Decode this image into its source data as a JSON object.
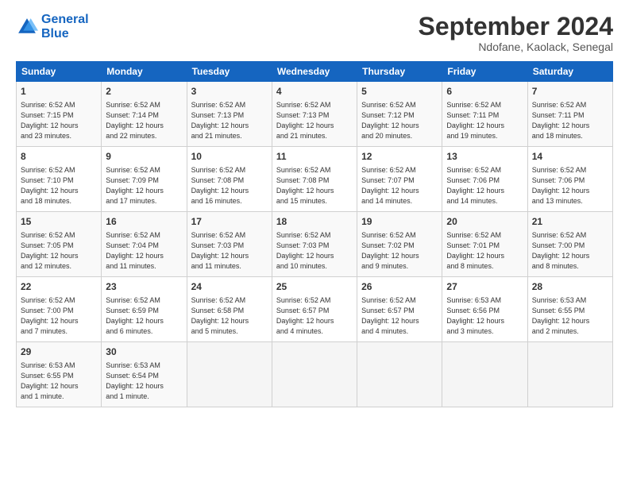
{
  "logo": {
    "line1": "General",
    "line2": "Blue"
  },
  "title": "September 2024",
  "subtitle": "Ndofane, Kaolack, Senegal",
  "days_of_week": [
    "Sunday",
    "Monday",
    "Tuesday",
    "Wednesday",
    "Thursday",
    "Friday",
    "Saturday"
  ],
  "weeks": [
    [
      {
        "day": "1",
        "info": "Sunrise: 6:52 AM\nSunset: 7:15 PM\nDaylight: 12 hours\nand 23 minutes."
      },
      {
        "day": "2",
        "info": "Sunrise: 6:52 AM\nSunset: 7:14 PM\nDaylight: 12 hours\nand 22 minutes."
      },
      {
        "day": "3",
        "info": "Sunrise: 6:52 AM\nSunset: 7:13 PM\nDaylight: 12 hours\nand 21 minutes."
      },
      {
        "day": "4",
        "info": "Sunrise: 6:52 AM\nSunset: 7:13 PM\nDaylight: 12 hours\nand 21 minutes."
      },
      {
        "day": "5",
        "info": "Sunrise: 6:52 AM\nSunset: 7:12 PM\nDaylight: 12 hours\nand 20 minutes."
      },
      {
        "day": "6",
        "info": "Sunrise: 6:52 AM\nSunset: 7:11 PM\nDaylight: 12 hours\nand 19 minutes."
      },
      {
        "day": "7",
        "info": "Sunrise: 6:52 AM\nSunset: 7:11 PM\nDaylight: 12 hours\nand 18 minutes."
      }
    ],
    [
      {
        "day": "8",
        "info": "Sunrise: 6:52 AM\nSunset: 7:10 PM\nDaylight: 12 hours\nand 18 minutes."
      },
      {
        "day": "9",
        "info": "Sunrise: 6:52 AM\nSunset: 7:09 PM\nDaylight: 12 hours\nand 17 minutes."
      },
      {
        "day": "10",
        "info": "Sunrise: 6:52 AM\nSunset: 7:08 PM\nDaylight: 12 hours\nand 16 minutes."
      },
      {
        "day": "11",
        "info": "Sunrise: 6:52 AM\nSunset: 7:08 PM\nDaylight: 12 hours\nand 15 minutes."
      },
      {
        "day": "12",
        "info": "Sunrise: 6:52 AM\nSunset: 7:07 PM\nDaylight: 12 hours\nand 14 minutes."
      },
      {
        "day": "13",
        "info": "Sunrise: 6:52 AM\nSunset: 7:06 PM\nDaylight: 12 hours\nand 14 minutes."
      },
      {
        "day": "14",
        "info": "Sunrise: 6:52 AM\nSunset: 7:06 PM\nDaylight: 12 hours\nand 13 minutes."
      }
    ],
    [
      {
        "day": "15",
        "info": "Sunrise: 6:52 AM\nSunset: 7:05 PM\nDaylight: 12 hours\nand 12 minutes."
      },
      {
        "day": "16",
        "info": "Sunrise: 6:52 AM\nSunset: 7:04 PM\nDaylight: 12 hours\nand 11 minutes."
      },
      {
        "day": "17",
        "info": "Sunrise: 6:52 AM\nSunset: 7:03 PM\nDaylight: 12 hours\nand 11 minutes."
      },
      {
        "day": "18",
        "info": "Sunrise: 6:52 AM\nSunset: 7:03 PM\nDaylight: 12 hours\nand 10 minutes."
      },
      {
        "day": "19",
        "info": "Sunrise: 6:52 AM\nSunset: 7:02 PM\nDaylight: 12 hours\nand 9 minutes."
      },
      {
        "day": "20",
        "info": "Sunrise: 6:52 AM\nSunset: 7:01 PM\nDaylight: 12 hours\nand 8 minutes."
      },
      {
        "day": "21",
        "info": "Sunrise: 6:52 AM\nSunset: 7:00 PM\nDaylight: 12 hours\nand 8 minutes."
      }
    ],
    [
      {
        "day": "22",
        "info": "Sunrise: 6:52 AM\nSunset: 7:00 PM\nDaylight: 12 hours\nand 7 minutes."
      },
      {
        "day": "23",
        "info": "Sunrise: 6:52 AM\nSunset: 6:59 PM\nDaylight: 12 hours\nand 6 minutes."
      },
      {
        "day": "24",
        "info": "Sunrise: 6:52 AM\nSunset: 6:58 PM\nDaylight: 12 hours\nand 5 minutes."
      },
      {
        "day": "25",
        "info": "Sunrise: 6:52 AM\nSunset: 6:57 PM\nDaylight: 12 hours\nand 4 minutes."
      },
      {
        "day": "26",
        "info": "Sunrise: 6:52 AM\nSunset: 6:57 PM\nDaylight: 12 hours\nand 4 minutes."
      },
      {
        "day": "27",
        "info": "Sunrise: 6:53 AM\nSunset: 6:56 PM\nDaylight: 12 hours\nand 3 minutes."
      },
      {
        "day": "28",
        "info": "Sunrise: 6:53 AM\nSunset: 6:55 PM\nDaylight: 12 hours\nand 2 minutes."
      }
    ],
    [
      {
        "day": "29",
        "info": "Sunrise: 6:53 AM\nSunset: 6:55 PM\nDaylight: 12 hours\nand 1 minute."
      },
      {
        "day": "30",
        "info": "Sunrise: 6:53 AM\nSunset: 6:54 PM\nDaylight: 12 hours\nand 1 minute."
      },
      {
        "day": "",
        "info": ""
      },
      {
        "day": "",
        "info": ""
      },
      {
        "day": "",
        "info": ""
      },
      {
        "day": "",
        "info": ""
      },
      {
        "day": "",
        "info": ""
      }
    ]
  ]
}
